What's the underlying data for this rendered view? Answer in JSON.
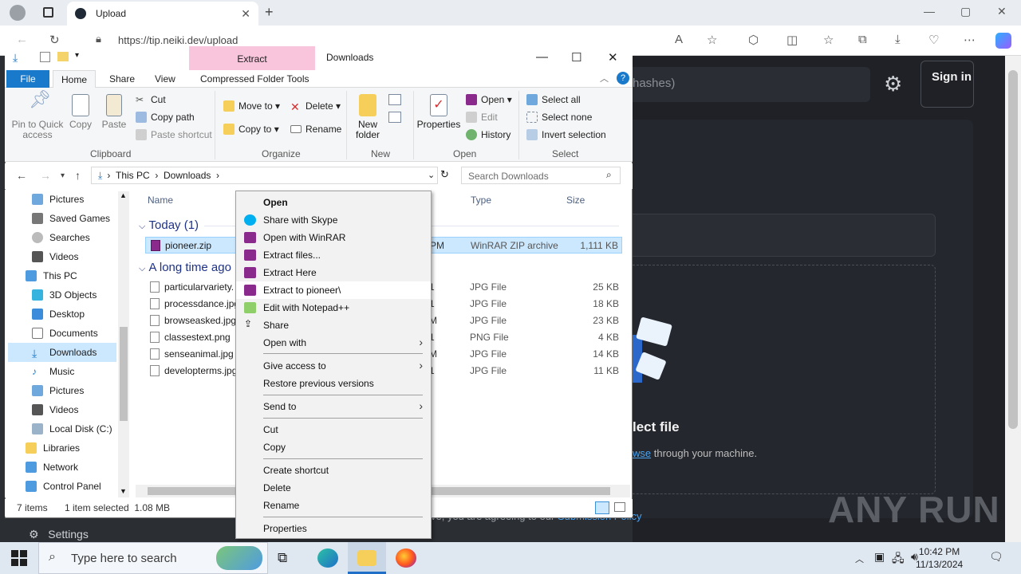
{
  "browser": {
    "tab_title": "Upload",
    "new_tab": "+",
    "url": "https://tip.neiki.dev/upload",
    "minimize": "—",
    "maximize": "▢",
    "close": "✕"
  },
  "website": {
    "search_placeholder": "hashes)",
    "signin": "Sign in",
    "select_file": "lect file",
    "browse_link": "wse",
    "browse_rest": " through your machine.",
    "agree_text": "ve, you are agreeing to our ",
    "agree_link": "Submission Policy",
    "settings_label": "Settings",
    "watermark": "ANY RUN"
  },
  "explorer": {
    "title": "Downloads",
    "context_tab": "Extract",
    "tabs": [
      "File",
      "Home",
      "Share",
      "View",
      "Compressed Folder Tools"
    ],
    "clipboard": {
      "pin": "Pin to Quick access",
      "copy": "Copy",
      "paste": "Paste",
      "cut": "Cut",
      "copy_path": "Copy path",
      "paste_shortcut": "Paste shortcut",
      "label": "Clipboard"
    },
    "organize": {
      "move_to": "Move to",
      "copy_to": "Copy to",
      "delete": "Delete",
      "rename": "Rename",
      "label": "Organize"
    },
    "new": {
      "new_folder": "New folder",
      "label": "New"
    },
    "open": {
      "properties": "Properties",
      "open": "Open",
      "edit": "Edit",
      "history": "History",
      "label": "Open"
    },
    "select": {
      "select_all": "Select all",
      "select_none": "Select none",
      "invert": "Invert selection",
      "label": "Select"
    },
    "path": [
      "This PC",
      "Downloads"
    ],
    "search_placeholder": "Search Downloads",
    "nav_items": [
      "Pictures",
      "Saved Games",
      "Searches",
      "Videos",
      "This PC",
      "3D Objects",
      "Desktop",
      "Documents",
      "Downloads",
      "Music",
      "Pictures",
      "Videos",
      "Local Disk (C:)",
      "Libraries",
      "Network",
      "Control Panel"
    ],
    "columns": {
      "name": "Name",
      "type": "Type",
      "size": "Size"
    },
    "groups": {
      "today": "Today (1)",
      "long_ago": "A long time ago"
    },
    "files_today": [
      {
        "name": "pioneer.zip",
        "date_part": "PM",
        "type": "WinRAR ZIP archive",
        "size": "1,111 KB"
      }
    ],
    "files_old": [
      {
        "name": "particularvariety.",
        "date_part": "1",
        "type": "JPG File",
        "size": "25 KB"
      },
      {
        "name": "processdance.jpg",
        "date_part": "1",
        "type": "JPG File",
        "size": "18 KB"
      },
      {
        "name": "browseasked.jpg",
        "date_part": "M",
        "type": "JPG File",
        "size": "23 KB"
      },
      {
        "name": "classestext.png",
        "date_part": "1",
        "type": "PNG File",
        "size": "4 KB"
      },
      {
        "name": "senseanimal.jpg",
        "date_part": "M",
        "type": "JPG File",
        "size": "14 KB"
      },
      {
        "name": "developterms.jpg",
        "date_part": "1",
        "type": "JPG File",
        "size": "11 KB"
      }
    ],
    "status": {
      "count": "7 items",
      "selected": "1 item selected  1.08 MB"
    }
  },
  "context_menu": {
    "items": [
      {
        "label": "Open",
        "icon": "none"
      },
      {
        "label": "Share with Skype",
        "icon": "skype-icon"
      },
      {
        "label": "Open with WinRAR",
        "icon": "winrar-icon"
      },
      {
        "label": "Extract files...",
        "icon": "winrar-icon"
      },
      {
        "label": "Extract Here",
        "icon": "winrar-icon"
      },
      {
        "label": "Extract to pioneer\\",
        "icon": "winrar-icon"
      },
      {
        "label": "Edit with Notepad++",
        "icon": "notepadpp-icon"
      },
      {
        "label": "Share",
        "icon": "share-icon"
      },
      {
        "label": "Open with",
        "icon": "none"
      },
      {
        "label": "Give access to",
        "icon": "none"
      },
      {
        "label": "Restore previous versions",
        "icon": "none"
      },
      {
        "label": "Send to",
        "icon": "none"
      },
      {
        "label": "Cut",
        "icon": "none"
      },
      {
        "label": "Copy",
        "icon": "none"
      },
      {
        "label": "Create shortcut",
        "icon": "none"
      },
      {
        "label": "Delete",
        "icon": "none"
      },
      {
        "label": "Rename",
        "icon": "none"
      },
      {
        "label": "Properties",
        "icon": "none"
      }
    ]
  },
  "taskbar": {
    "search_placeholder": "Type here to search",
    "time": "10:42 PM",
    "date": "11/13/2024"
  },
  "colors": {
    "accent": "#1979ca",
    "selection": "#cce8ff",
    "extract_tab": "#f9c5dc",
    "site_bg": "#1f2126",
    "link": "#4aa3f0"
  }
}
